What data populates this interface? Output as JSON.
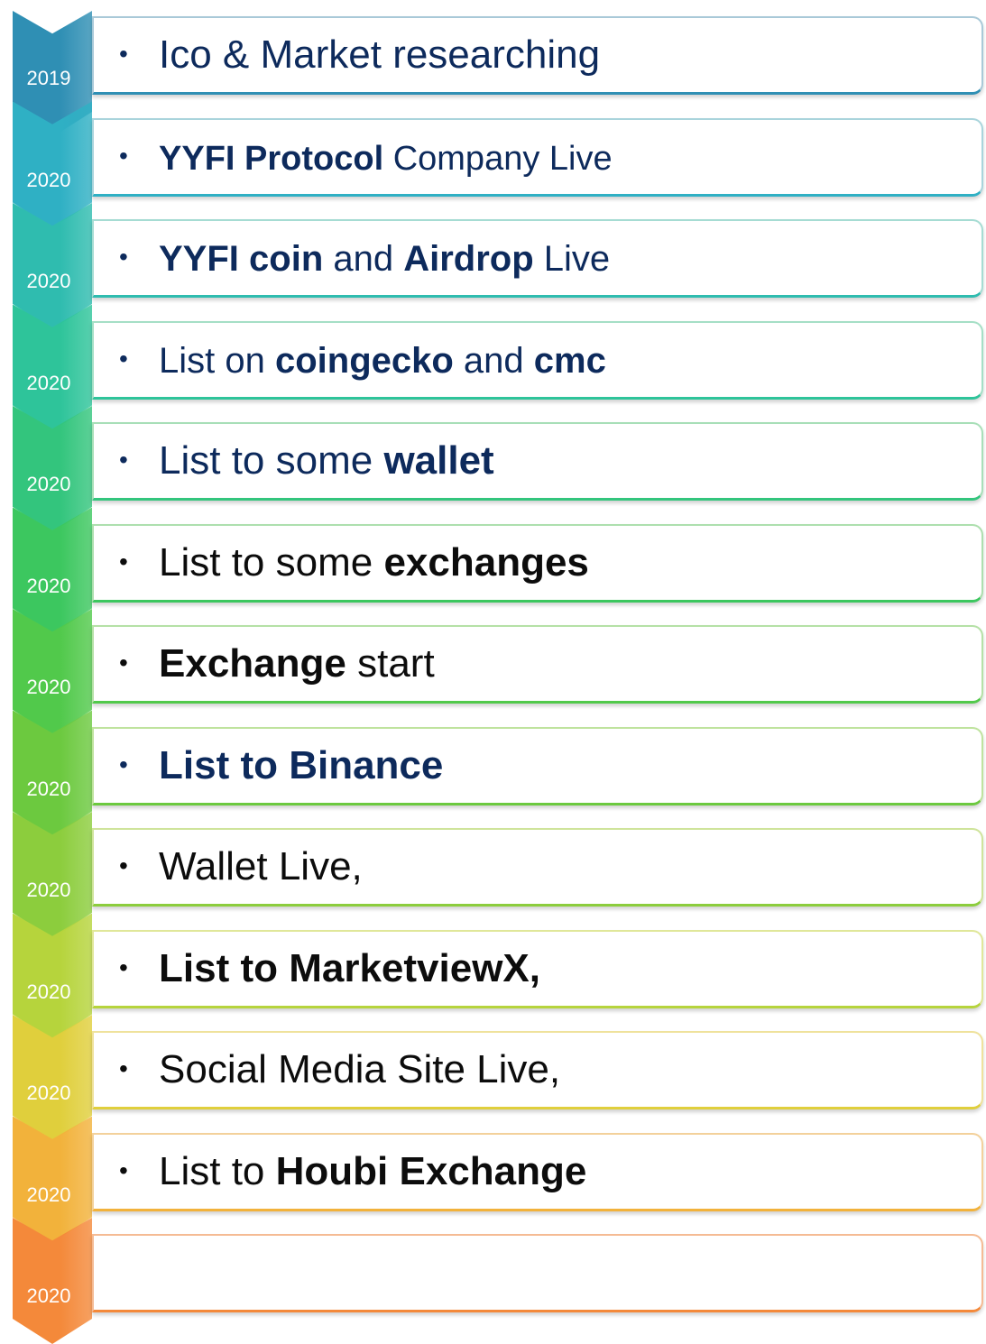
{
  "steps": [
    {
      "year": "2019",
      "color": "#2f8fb4",
      "border": "#a9c9d8",
      "segments": [
        {
          "text": "Ico & Market researching",
          "bold": false
        }
      ],
      "text_color": "#0d2a5c",
      "size": 44
    },
    {
      "year": "2020",
      "color": "#2fb0c4",
      "border": "#a9d4dc",
      "segments": [
        {
          "text": "YYFI Protocol",
          "bold": true
        },
        {
          "text": " Company Live",
          "bold": false
        }
      ],
      "text_color": "#0d2a5c",
      "size": 38
    },
    {
      "year": "2020",
      "color": "#2fbcaf",
      "border": "#a6dcd3",
      "segments": [
        {
          "text": "YYFI coin",
          "bold": true
        },
        {
          "text": " and ",
          "bold": false
        },
        {
          "text": "Airdrop",
          "bold": true
        },
        {
          "text": " Live",
          "bold": false
        }
      ],
      "text_color": "#0d2a5c",
      "size": 40
    },
    {
      "year": "2020",
      "color": "#2ec49a",
      "border": "#a5dfc6",
      "segments": [
        {
          "text": "List on ",
          "bold": false
        },
        {
          "text": "coingecko",
          "bold": true
        },
        {
          "text": " and ",
          "bold": false
        },
        {
          "text": "cmc",
          "bold": true
        }
      ],
      "text_color": "#0d2a5c",
      "size": 40
    },
    {
      "year": "2020",
      "color": "#33c57d",
      "border": "#a8dfb8",
      "segments": [
        {
          "text": "List to some ",
          "bold": false
        },
        {
          "text": "wallet",
          "bold": true
        }
      ],
      "text_color": "#0d2a5c",
      "size": 44
    },
    {
      "year": "2020",
      "color": "#3cc75f",
      "border": "#addfae",
      "segments": [
        {
          "text": "List to some ",
          "bold": false
        },
        {
          "text": "exchanges",
          "bold": true
        }
      ],
      "text_color": "#0c0c0c",
      "size": 44
    },
    {
      "year": "2020",
      "color": "#51c94b",
      "border": "#b5e1a6",
      "segments": [
        {
          "text": "Exchange",
          "bold": true
        },
        {
          "text": " start",
          "bold": false
        }
      ],
      "text_color": "#0c0c0c",
      "size": 44
    },
    {
      "year": "2020",
      "color": "#6cc93f",
      "border": "#bfe39e",
      "segments": [
        {
          "text": "List to Binance",
          "bold": true
        }
      ],
      "text_color": "#0d2a5c",
      "size": 44
    },
    {
      "year": "2020",
      "color": "#8ccd3d",
      "border": "#cfe49b",
      "segments": [
        {
          "text": "Wallet Live,",
          "bold": false
        }
      ],
      "text_color": "#0c0c0c",
      "size": 44
    },
    {
      "year": "2020",
      "color": "#b6d43c",
      "border": "#e0e79a",
      "segments": [
        {
          "text": "List to MarketviewX,",
          "bold": true
        }
      ],
      "text_color": "#0c0c0c",
      "size": 44
    },
    {
      "year": "2020",
      "color": "#e0cf3c",
      "border": "#efe29c",
      "segments": [
        {
          "text": "Social Media Site Live,",
          "bold": false
        }
      ],
      "text_color": "#0c0c0c",
      "size": 44
    },
    {
      "year": "2020",
      "color": "#f2b23b",
      "border": "#f3d19b",
      "segments": [
        {
          "text": "List to ",
          "bold": false
        },
        {
          "text": "Houbi Exchange",
          "bold": true
        }
      ],
      "text_color": "#0c0c0c",
      "size": 44
    },
    {
      "year": "2020",
      "color": "#f4893a",
      "border": "#f5bb94",
      "segments": [],
      "text_color": "#0c0c0c",
      "size": 44
    }
  ],
  "bullet": "•"
}
